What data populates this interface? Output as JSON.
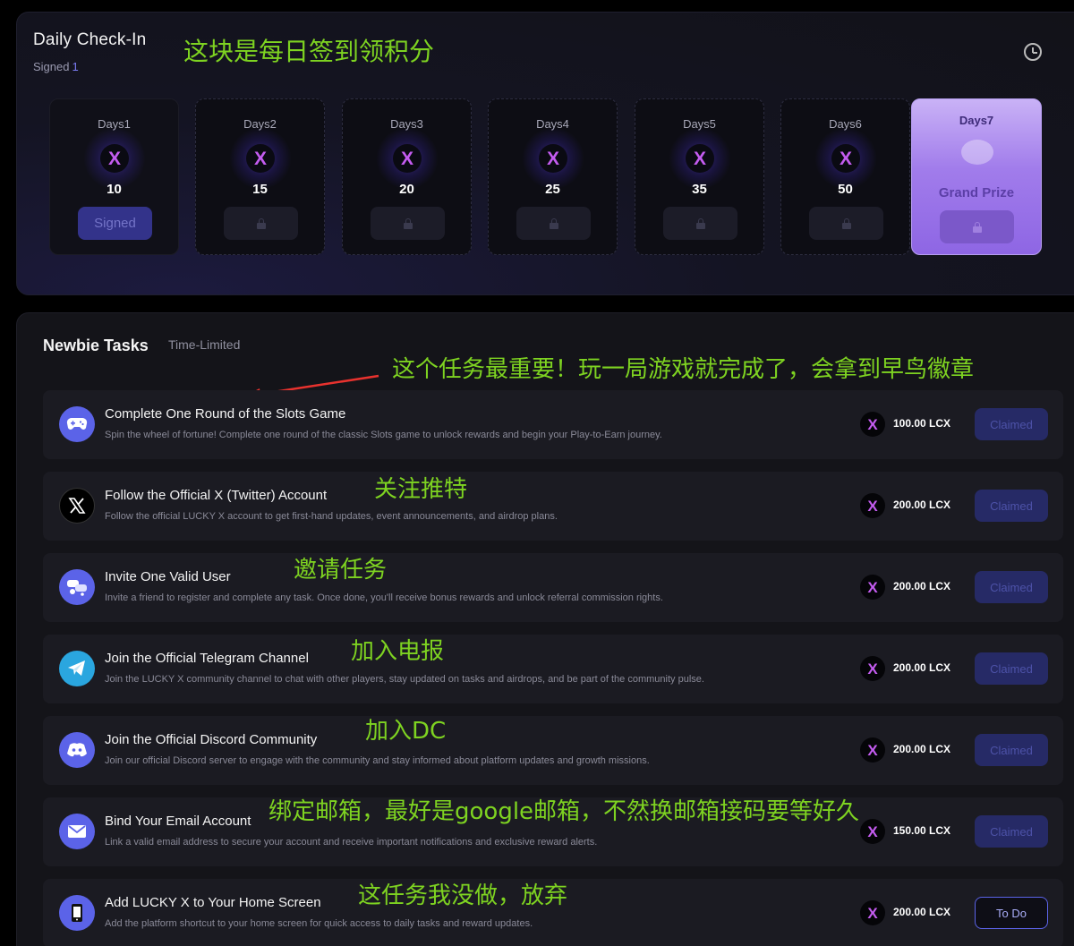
{
  "checkin": {
    "title": "Daily Check-In",
    "signed_label": "Signed",
    "signed_count": "1",
    "annotation": "这块是每日签到领积分",
    "days": [
      {
        "label": "Days1",
        "value": "10",
        "status": "Signed"
      },
      {
        "label": "Days2",
        "value": "15",
        "status": "locked"
      },
      {
        "label": "Days3",
        "value": "20",
        "status": "locked"
      },
      {
        "label": "Days4",
        "value": "25",
        "status": "locked"
      },
      {
        "label": "Days5",
        "value": "35",
        "status": "locked"
      },
      {
        "label": "Days6",
        "value": "50",
        "status": "locked"
      }
    ],
    "grand": {
      "label": "Days7",
      "title": "Grand Prize",
      "status": "locked"
    },
    "coin_glyph": "X"
  },
  "tasks": {
    "title": "Newbie Tasks",
    "subtitle": "Time-Limited",
    "annotation": "这个任务最重要！玩一局游戏就完成了，会拿到早鸟徽章",
    "items": [
      {
        "title": "Complete One Round of the Slots Game",
        "desc": "Spin the wheel of fortune! Complete one round of the classic Slots game to unlock rewards and begin your Play-to-Earn journey.",
        "reward": "100.00 LCX",
        "button": "Claimed",
        "icon": "gamepad-icon",
        "annotation": ""
      },
      {
        "title": "Follow the Official X (Twitter) Account",
        "desc": "Follow the official LUCKY X account to get first-hand updates, event announcements, and airdrop plans.",
        "reward": "200.00 LCX",
        "button": "Claimed",
        "icon": "x-logo-icon",
        "annotation": "关注推特"
      },
      {
        "title": "Invite One Valid User",
        "desc": "Invite a friend to register and complete any task. Once done, you'll receive bonus rewards and unlock referral commission rights.",
        "reward": "200.00 LCX",
        "button": "Claimed",
        "icon": "invite-icon",
        "annotation": "邀请任务"
      },
      {
        "title": "Join the Official Telegram Channel",
        "desc": "Join the LUCKY X community channel to chat with other players, stay updated on tasks and airdrops, and be part of the community pulse.",
        "reward": "200.00 LCX",
        "button": "Claimed",
        "icon": "telegram-icon",
        "annotation": "加入电报"
      },
      {
        "title": "Join the Official Discord Community",
        "desc": "Join our official Discord server to engage with the community and stay informed about platform updates and growth missions.",
        "reward": "200.00 LCX",
        "button": "Claimed",
        "icon": "discord-icon",
        "annotation": "加入DC"
      },
      {
        "title": "Bind Your Email Account",
        "desc": "Link a valid email address to secure your account and receive important notifications and exclusive reward alerts.",
        "reward": "150.00 LCX",
        "button": "Claimed",
        "icon": "email-icon",
        "annotation": "绑定邮箱，最好是google邮箱，不然换邮箱接码要等好久"
      },
      {
        "title": "Add LUCKY X to Your Home Screen",
        "desc": "Add the platform shortcut to your home screen for quick access to daily tasks and reward updates.",
        "reward": "200.00 LCX",
        "button": "To Do",
        "icon": "phone-icon",
        "annotation": "这任务我没做，放弃"
      }
    ]
  },
  "colors": {
    "accent": "#5b63e8",
    "annotation": "#7ed321",
    "coin": "#c45cf0",
    "grand_prize": "#a17ceb"
  }
}
